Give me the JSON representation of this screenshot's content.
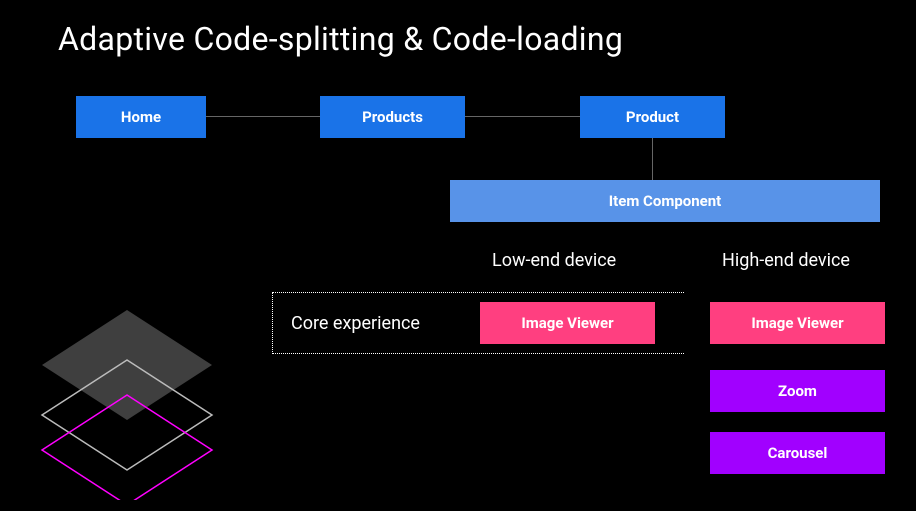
{
  "title": "Adaptive Code-splitting & Code-loading",
  "nav": {
    "home": "Home",
    "products": "Products",
    "product": "Product"
  },
  "item_component": "Item Component",
  "columns": {
    "low": "Low-end device",
    "high": "High-end device"
  },
  "core_experience_label": "Core experience",
  "modules": {
    "low": {
      "image_viewer": "Image Viewer"
    },
    "high": {
      "image_viewer": "Image Viewer",
      "zoom": "Zoom",
      "carousel": "Carousel"
    }
  },
  "colors": {
    "blue": "#1a73e8",
    "light_blue": "#5893e8",
    "pink": "#ff3f80",
    "purple": "#a100ff",
    "magenta_outline": "#ff00ff"
  }
}
